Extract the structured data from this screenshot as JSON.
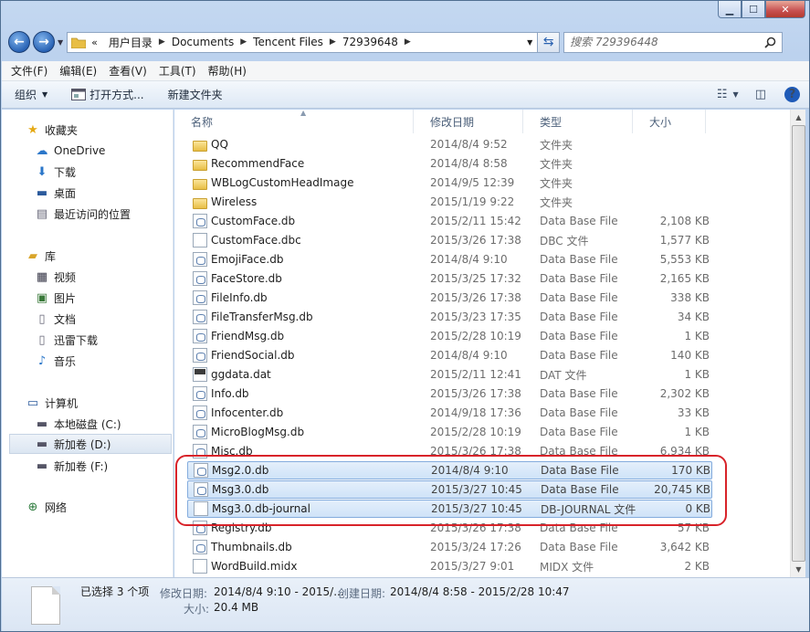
{
  "window": {
    "caption_buttons": {
      "minimize": "▁",
      "maximize": "☐",
      "close": "✕"
    }
  },
  "address": {
    "breadcrumbs": [
      "用户目录",
      "Documents",
      "Tencent Files",
      "72939648"
    ],
    "search_placeholder": "搜索 729396448"
  },
  "menu": [
    "文件(F)",
    "编辑(E)",
    "查看(V)",
    "工具(T)",
    "帮助(H)"
  ],
  "toolbar": {
    "organize": "组织",
    "open_with": "打开方式...",
    "new_folder": "新建文件夹"
  },
  "nav": {
    "favorites": "收藏夹",
    "onedrive": "OneDrive",
    "downloads": "下载",
    "desktop": "桌面",
    "recent": "最近访问的位置",
    "libraries": "库",
    "videos": "视频",
    "pictures": "图片",
    "documents": "文档",
    "xunlei": "迅雷下载",
    "music": "音乐",
    "computer": "计算机",
    "disk_c": "本地磁盘 (C:)",
    "disk_d": "新加卷 (D:)",
    "disk_f": "新加卷 (F:)",
    "network": "网络"
  },
  "columns": {
    "name": "名称",
    "date": "修改日期",
    "type": "类型",
    "size": "大小"
  },
  "files": [
    {
      "name": "QQ",
      "date": "2014/8/4 9:52",
      "type": "文件夹",
      "size": "",
      "icon": "folder"
    },
    {
      "name": "RecommendFace",
      "date": "2014/8/4 8:58",
      "type": "文件夹",
      "size": "",
      "icon": "folder"
    },
    {
      "name": "WBLogCustomHeadImage",
      "date": "2014/9/5 12:39",
      "type": "文件夹",
      "size": "",
      "icon": "folder"
    },
    {
      "name": "Wireless",
      "date": "2015/1/19 9:22",
      "type": "文件夹",
      "size": "",
      "icon": "folder"
    },
    {
      "name": "CustomFace.db",
      "date": "2015/2/11 15:42",
      "type": "Data Base File",
      "size": "2,108 KB",
      "icon": "db"
    },
    {
      "name": "CustomFace.dbc",
      "date": "2015/3/26 17:38",
      "type": "DBC 文件",
      "size": "1,577 KB",
      "icon": "file"
    },
    {
      "name": "EmojiFace.db",
      "date": "2014/8/4 9:10",
      "type": "Data Base File",
      "size": "5,553 KB",
      "icon": "db"
    },
    {
      "name": "FaceStore.db",
      "date": "2015/3/25 17:32",
      "type": "Data Base File",
      "size": "2,165 KB",
      "icon": "db"
    },
    {
      "name": "FileInfo.db",
      "date": "2015/3/26 17:38",
      "type": "Data Base File",
      "size": "338 KB",
      "icon": "db"
    },
    {
      "name": "FileTransferMsg.db",
      "date": "2015/3/23 17:35",
      "type": "Data Base File",
      "size": "34 KB",
      "icon": "db"
    },
    {
      "name": "FriendMsg.db",
      "date": "2015/2/28 10:19",
      "type": "Data Base File",
      "size": "1 KB",
      "icon": "db"
    },
    {
      "name": "FriendSocial.db",
      "date": "2014/8/4 9:10",
      "type": "Data Base File",
      "size": "140 KB",
      "icon": "db"
    },
    {
      "name": "ggdata.dat",
      "date": "2015/2/11 12:41",
      "type": "DAT 文件",
      "size": "1 KB",
      "icon": "dat"
    },
    {
      "name": "Info.db",
      "date": "2015/3/26 17:38",
      "type": "Data Base File",
      "size": "2,302 KB",
      "icon": "db"
    },
    {
      "name": "Infocenter.db",
      "date": "2014/9/18 17:36",
      "type": "Data Base File",
      "size": "33 KB",
      "icon": "db"
    },
    {
      "name": "MicroBlogMsg.db",
      "date": "2015/2/28 10:19",
      "type": "Data Base File",
      "size": "1 KB",
      "icon": "db"
    },
    {
      "name": "Misc.db",
      "date": "2015/3/26 17:38",
      "type": "Data Base File",
      "size": "6,934 KB",
      "icon": "db"
    },
    {
      "name": "Msg2.0.db",
      "date": "2014/8/4 9:10",
      "type": "Data Base File",
      "size": "170 KB",
      "icon": "db",
      "selected": true
    },
    {
      "name": "Msg3.0.db",
      "date": "2015/3/27 10:45",
      "type": "Data Base File",
      "size": "20,745 KB",
      "icon": "db",
      "selected": true
    },
    {
      "name": "Msg3.0.db-journal",
      "date": "2015/3/27 10:45",
      "type": "DB-JOURNAL 文件",
      "size": "0 KB",
      "icon": "file",
      "selected": true
    },
    {
      "name": "Registry.db",
      "date": "2015/3/26 17:38",
      "type": "Data Base File",
      "size": "57 KB",
      "icon": "db"
    },
    {
      "name": "Thumbnails.db",
      "date": "2015/3/24 17:26",
      "type": "Data Base File",
      "size": "3,642 KB",
      "icon": "db"
    },
    {
      "name": "WordBuild.midx",
      "date": "2015/3/27 9:01",
      "type": "MIDX 文件",
      "size": "2 KB",
      "icon": "file"
    }
  ],
  "details": {
    "selected": "已选择 3 个项",
    "modified_label": "修改日期:",
    "modified_value": "2014/8/4 9:10 - 2015/...",
    "created_label": "创建日期:",
    "created_value": "2014/8/4 8:58 - 2015/2/28 10:47",
    "size_label": "大小:",
    "size_value": "20.4 MB"
  }
}
